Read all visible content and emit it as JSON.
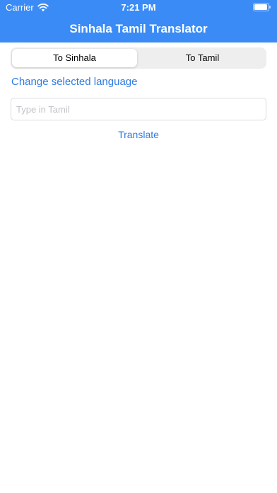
{
  "status_bar": {
    "carrier": "Carrier",
    "time": "7:21 PM",
    "icons": [
      "wifi-icon",
      "battery-icon"
    ]
  },
  "nav": {
    "title": "Sinhala Tamil Translator",
    "background_color": "#3a8bf6"
  },
  "segmented": {
    "options": [
      "To Sinhala",
      "To Tamil"
    ],
    "selected": "To Sinhala"
  },
  "change_language_label": "Change selected language",
  "input": {
    "value": "",
    "placeholder": "Type in Tamil"
  },
  "translate_label": "Translate",
  "accent_color": "#2f7be0"
}
